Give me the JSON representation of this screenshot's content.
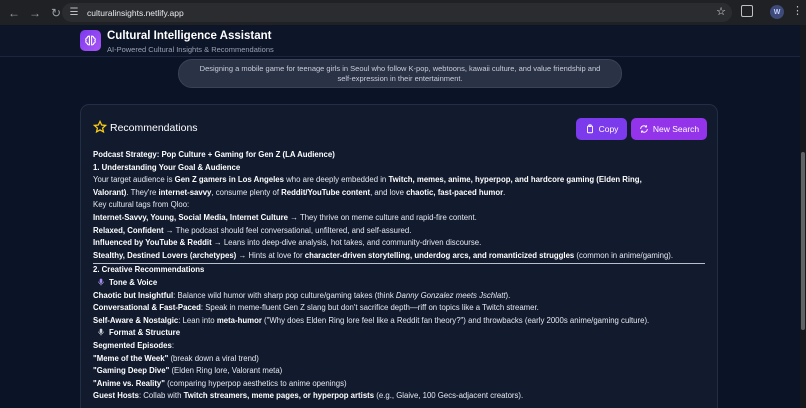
{
  "browser": {
    "url": "culturalinsights.netlify.app",
    "profile_initial": "W",
    "back_icon": "arrow-left-icon",
    "forward_icon": "arrow-right-icon",
    "reload_icon": "reload-icon"
  },
  "header": {
    "title": "Cultural Intelligence Assistant",
    "subtitle": "AI-Powered Cultural Insights & Recommendations"
  },
  "query": {
    "text": "Designing a mobile game for teenage girls in Seoul who follow K-pop, webtoons, kawaii culture, and value friendship and self-expression in their entertainment."
  },
  "recommendations": {
    "title": "Recommendations",
    "copy_label": "Copy",
    "new_search_label": "New Search"
  },
  "content": {
    "l1": "Podcast Strategy: Pop Culture + Gaming for Gen Z (LA Audience)",
    "l2": "1. Understanding Your Goal & Audience",
    "l3a": "Your target audience is ",
    "l3b": "Gen Z gamers in Los Angeles",
    "l3c": " who are deeply embedded in ",
    "l3d": "Twitch, memes, anime, hyperpop, and hardcore gaming (Elden Ring,",
    "l4a": "Valorant)",
    "l4b": ". They're ",
    "l4c": "internet-savvy",
    "l4d": ", consume plenty of ",
    "l4e": "Reddit/YouTube content",
    "l4f": ", and love ",
    "l4g": "chaotic, fast-paced humor",
    "l4h": ".",
    "l5": "Key cultural tags from Qloo:",
    "l6a": "Internet-Savvy, Young, Social Media, Internet Culture",
    "l6b": " → They thrive on meme culture and rapid-fire content.",
    "l7a": "Relaxed, Confident",
    "l7b": " → The podcast should feel conversational, unfiltered, and self-assured.",
    "l8a": "Influenced by YouTube & Reddit",
    "l8b": " → Leans into deep-dive analysis, hot takes, and community-driven discourse.",
    "l9a": "Stealthy, Destined Lovers (archetypes)",
    "l9b": " → Hints at love for ",
    "l9c": "character-driven storytelling, underdog arcs, and romanticized struggles",
    "l9d": " (common in anime/gaming).",
    "l10": "2. Creative Recommendations",
    "l11": "Tone & Voice",
    "l12a": "Chaotic but Insightful",
    "l12b": ": Balance wild humor with sharp pop culture/gaming takes (think ",
    "l12c": "Danny Gonzalez meets Jschlatt",
    "l12d": ").",
    "l13a": "Conversational & Fast-Paced",
    "l13b": ": Speak in meme-fluent Gen Z slang but don't sacrifice depth—riff on topics like a Twitch streamer.",
    "l14a": "Self-Aware & Nostalgic",
    "l14b": ": Lean into ",
    "l14c": "meta-humor",
    "l14d": " (\"Why does Elden Ring lore feel like a Reddit fan theory?\") and throwbacks (early 2000s anime/gaming culture).",
    "l15": "Format & Structure",
    "l16": "Segmented Episodes",
    "l16b": ":",
    "l17a": "\"Meme of the Week\"",
    "l17b": " (break down a viral trend)",
    "l18a": "\"Gaming Deep Dive\"",
    "l18b": " (Elden Ring lore, Valorant meta)",
    "l19a": "\"Anime vs. Reality\"",
    "l19b": " (comparing hyperpop aesthetics to anime openings)",
    "l20a": "Guest Hosts",
    "l20b": ": Collab with ",
    "l20c": "Twitch streamers, meme pages, or hyperpop artists",
    "l20d": " (e.g., Glaive, 100 Gecs-adjacent creators)."
  }
}
